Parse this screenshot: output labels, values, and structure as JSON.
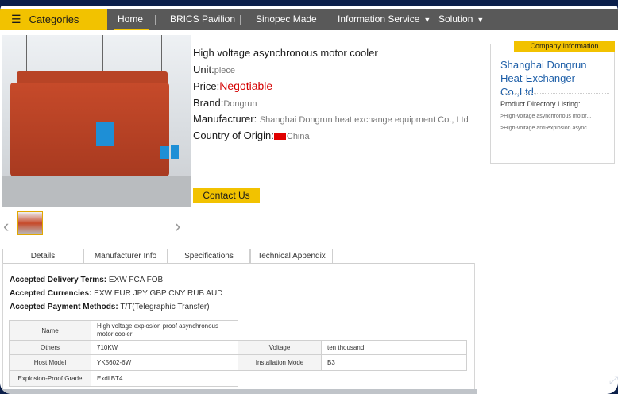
{
  "nav": {
    "categories_label": "Categories",
    "items": [
      {
        "label": "Home"
      },
      {
        "label": "BRICS Pavilion"
      },
      {
        "label": "Sinopec Made"
      },
      {
        "label": "Information Service"
      },
      {
        "label": "Solution"
      }
    ]
  },
  "product": {
    "title": "High voltage asynchronous motor cooler",
    "unit_label": "Unit:",
    "unit_value": "piece",
    "price_label": "Price:",
    "price_value": "Negotiable",
    "brand_label": "Brand:",
    "brand_value": "Dongrun",
    "manufacturer_label": "Manufacturer:",
    "manufacturer_value": "Shanghai Dongrun heat exchange equipment Co., Ltd",
    "origin_label": "Country of Origin:",
    "origin_value": "China",
    "contact_button": "Contact Us"
  },
  "company": {
    "tab_label": "Company Information",
    "name": "Shanghai Dongrun Heat-Exchanger Co.,Ltd.",
    "directory_title": "Product Directory Listing:",
    "directory_items": [
      ">High-voltage asynchronous motor...",
      ">High-voltage anti-explosion async..."
    ]
  },
  "tabs": [
    {
      "label": "Details"
    },
    {
      "label": "Manufacturer Info"
    },
    {
      "label": "Specifications"
    },
    {
      "label": "Technical Appendix"
    }
  ],
  "details": {
    "delivery_label": "Accepted Delivery Terms:",
    "delivery_value": "EXW FCA FOB",
    "currencies_label": "Accepted Currencies:",
    "currencies_value": "EXW EUR JPY GBP CNY RUB AUD",
    "payment_label": "Accepted Payment Methods:",
    "payment_value": "T/T(Telegraphic Transfer)"
  },
  "spec_table": {
    "name_key": "Name",
    "name_value": "High voltage explosion proof asynchronous motor cooler",
    "others_key": "Others",
    "others_value": "710KW",
    "voltage_key": "Voltage",
    "voltage_value": "ten thousand",
    "host_model_key": "Host Model",
    "host_model_value": "YK5602-6W",
    "install_key": "Installation Mode",
    "install_value": "B3",
    "explosion_key": "Explosion-Proof Grade",
    "explosion_value": "ExdⅡBT4"
  },
  "colors": {
    "accent": "#f2c200",
    "nav_bg": "#595959",
    "price": "#d40000",
    "company_name": "#1e5fa8",
    "frame": "#0b1f4a"
  }
}
